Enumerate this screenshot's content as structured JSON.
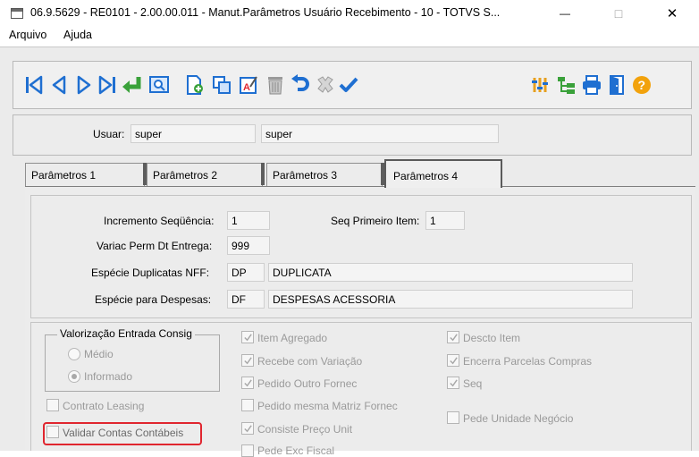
{
  "window": {
    "title": "06.9.5629 - RE0101 - 2.00.00.011 - Manut.Parâmetros Usuário Recebimento - 10 - TOTVS S...",
    "minimize": "—",
    "maximize": "□",
    "close": "✕"
  },
  "menu": [
    "Arquivo",
    "Ajuda"
  ],
  "toolbar": {
    "icons": [
      "first-record-icon",
      "previous-record-icon",
      "next-record-icon",
      "last-record-icon",
      "goto-icon",
      "search-icon",
      "new-icon",
      "copy-icon",
      "edit-icon",
      "delete-icon",
      "undo-icon",
      "cancel-icon",
      "confirm-icon",
      "settings-icon",
      "tree-icon",
      "print-icon",
      "exit-icon",
      "help-icon"
    ]
  },
  "user": {
    "label": "Usuar:",
    "code": "super",
    "name": "super"
  },
  "tabs": [
    "Parâmetros 1",
    "Parâmetros 2",
    "Parâmetros 3",
    "Parâmetros 4"
  ],
  "active_tab": "Parâmetros 4",
  "params": {
    "incremento_label": "Incremento Seqüência:",
    "incremento_value": "1",
    "seq_primeiro_label": "Seq Primeiro Item:",
    "seq_primeiro_value": "1",
    "variac_label": "Variac Perm Dt Entrega:",
    "variac_value": "999",
    "especie_dup_label": "Espécie Duplicatas NFF:",
    "especie_dup_code": "DP",
    "especie_dup_desc": "DUPLICATA",
    "especie_desp_label": "Espécie para Despesas:",
    "especie_desp_code": "DF",
    "especie_desp_desc": "DESPESAS ACESSORIA"
  },
  "valorizacao": {
    "title": "Valorização Entrada Consig",
    "options": [
      "Médio",
      "Informado"
    ],
    "selected": "Informado"
  },
  "checkboxes": {
    "contrato_leasing": {
      "label": "Contrato Leasing",
      "checked": false
    },
    "validar_contas": {
      "label": "Validar Contas Contábeis",
      "checked": false
    },
    "item_agregado": {
      "label": "Item Agregado",
      "checked": true
    },
    "recebe_variacao": {
      "label": "Recebe com Variação",
      "checked": true
    },
    "pedido_outro": {
      "label": "Pedido Outro Fornec",
      "checked": true
    },
    "pedido_mesma": {
      "label": "Pedido mesma Matriz Fornec",
      "checked": false
    },
    "consiste_preco": {
      "label": "Consiste Preço Unit",
      "checked": true
    },
    "pede_exc_fiscal": {
      "label": "Pede Exc Fiscal",
      "checked": false
    },
    "descto_item": {
      "label": "Descto Item",
      "checked": true
    },
    "encerra_parcelas": {
      "label": "Encerra Parcelas Compras",
      "checked": true
    },
    "seq": {
      "label": "Seq",
      "checked": true
    },
    "pede_unidade": {
      "label": "Pede Unidade Negócio",
      "checked": false
    }
  },
  "colors": {
    "highlight": "#e0262f",
    "nav_blue": "#1f6fd1",
    "add_green": "#3aa13a"
  }
}
